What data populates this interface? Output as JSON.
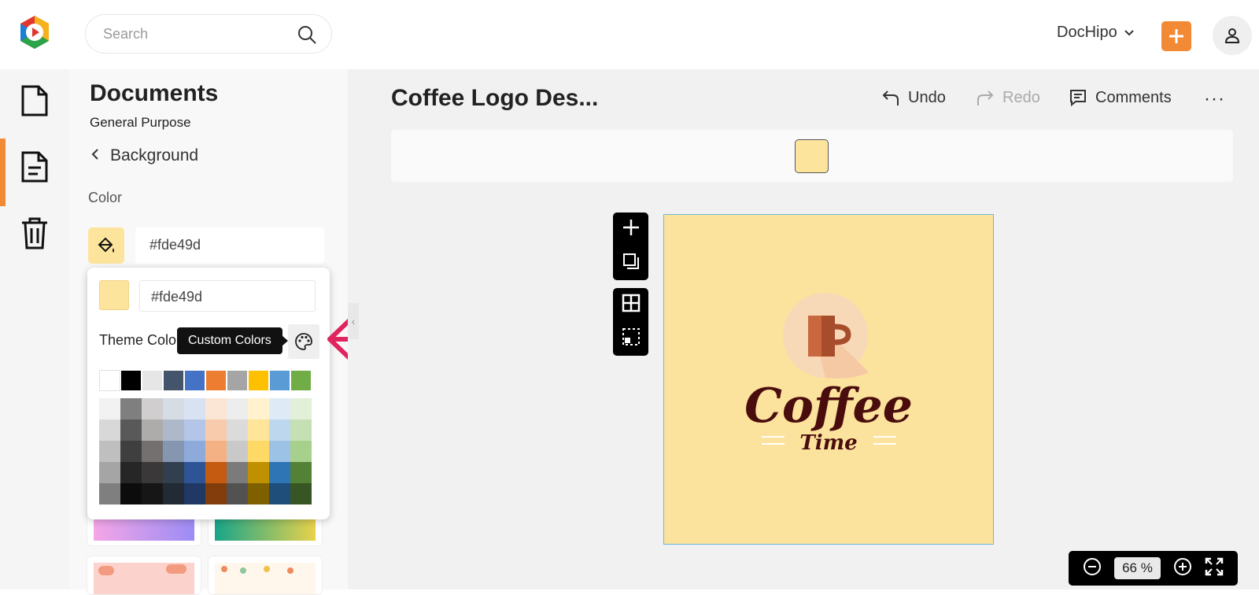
{
  "app": {
    "logo": "dochipo-logo"
  },
  "header": {
    "search_placeholder": "Search",
    "account_name": "DocHipo",
    "account_chevron_icon": "chevron-down-icon",
    "create_icon": "plus-icon",
    "user_icon": "user-icon"
  },
  "rail": {
    "items": [
      {
        "icon": "document-icon"
      },
      {
        "icon": "file-text-icon",
        "active": true
      },
      {
        "icon": "trash-icon"
      }
    ]
  },
  "panel": {
    "title": "Documents",
    "subtitle": "General Purpose",
    "back_label": "Background",
    "color_label": "Color",
    "color_value": "#fde49d"
  },
  "popup": {
    "hex_value": "#fde49d",
    "theme_label": "Theme Colors",
    "tooltip": "Custom Colors",
    "theme_row": [
      "#ffffff",
      "#000000",
      "#e7e6e6",
      "#44546a",
      "#4472c4",
      "#ed7d31",
      "#a5a5a5",
      "#ffc000",
      "#5b9bd5",
      "#70ad47"
    ],
    "shades": [
      [
        "#f2f2f2",
        "#d8d8d8",
        "#bfbfbf",
        "#a5a5a5",
        "#7f7f7f"
      ],
      [
        "#7f7f7f",
        "#595959",
        "#3f3f3f",
        "#262626",
        "#0c0c0c"
      ],
      [
        "#d0cece",
        "#aeabab",
        "#757070",
        "#3a3838",
        "#171616"
      ],
      [
        "#d6dce4",
        "#adb9ca",
        "#8496b0",
        "#323f4f",
        "#222a35"
      ],
      [
        "#d9e2f3",
        "#b4c6e7",
        "#8eaadb",
        "#2f5496",
        "#1f3864"
      ],
      [
        "#fbe5d5",
        "#f7cbac",
        "#f4b183",
        "#c55a11",
        "#833c0b"
      ],
      [
        "#ededed",
        "#dbdbdb",
        "#c9c9c9",
        "#7b7b7b",
        "#525252"
      ],
      [
        "#fff2cc",
        "#fee599",
        "#ffd965",
        "#bf9000",
        "#7f6000"
      ],
      [
        "#deebf6",
        "#bdd7ee",
        "#9cc3e5",
        "#2e75b5",
        "#1e4e79"
      ],
      [
        "#e2efd9",
        "#c5e0b3",
        "#a8d08d",
        "#538135",
        "#375623"
      ]
    ]
  },
  "editor": {
    "doc_title": "Coffee Logo Des...",
    "undo_label": "Undo",
    "redo_label": "Redo",
    "comments_label": "Comments",
    "more_label": "···",
    "canvas_bg": "#fbe29d",
    "logo_text_main": "Coffee",
    "logo_text_sub": "Time",
    "zoom_value": "66",
    "zoom_unit": "%"
  },
  "colors": {
    "accent": "#f28a35",
    "arrow": "#e0245e",
    "logo_text": "#4a0d0d"
  }
}
